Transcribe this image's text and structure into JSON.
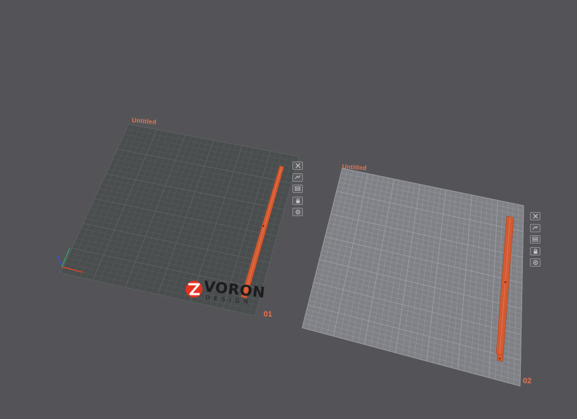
{
  "plates": [
    {
      "title": "Untitled",
      "number": "01",
      "logo": {
        "text": "VORON",
        "subtext": "DESIGN",
        "brand_color": "#e3331f"
      },
      "tools": [
        {
          "icon": "close-icon"
        },
        {
          "icon": "arrange-icon"
        },
        {
          "icon": "layers-icon"
        },
        {
          "icon": "lock-icon"
        },
        {
          "icon": "settings-icon"
        }
      ]
    },
    {
      "title": "Untitled",
      "number": "02",
      "tools": [
        {
          "icon": "close-icon"
        },
        {
          "icon": "arrange-icon"
        },
        {
          "icon": "layers-icon"
        },
        {
          "icon": "lock-icon"
        },
        {
          "icon": "settings-icon"
        }
      ]
    }
  ],
  "colors": {
    "background": "#545458",
    "plate_dark": "#4a4d4d",
    "plate_light": "#7f8186",
    "part": "#d45a32",
    "accent": "#e8734f"
  }
}
